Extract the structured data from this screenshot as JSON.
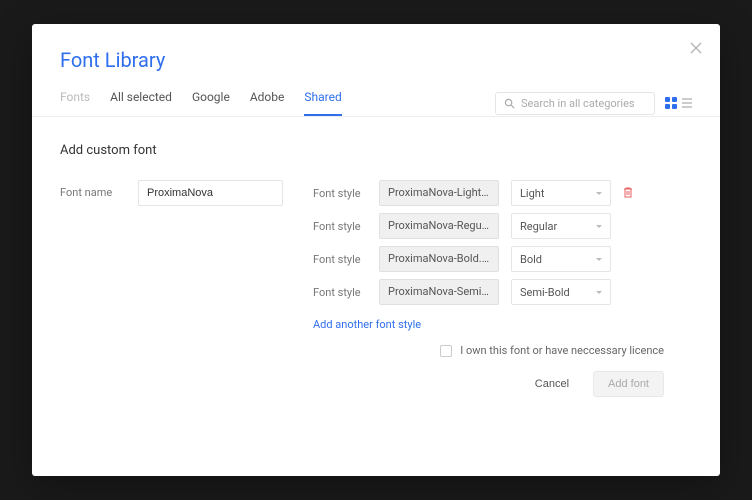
{
  "header": {
    "title": "Font Library"
  },
  "tabs": [
    "Fonts",
    "All selected",
    "Google",
    "Adobe",
    "Shared"
  ],
  "active_tab": 4,
  "search": {
    "placeholder": "Search in all categories"
  },
  "section": {
    "title": "Add custom font"
  },
  "font_name": {
    "label": "Font name",
    "value": "ProximaNova"
  },
  "style_label": "Font style",
  "styles": [
    {
      "file": "ProximaNova-Light.woff",
      "weight": "Light"
    },
    {
      "file": "ProximaNova-Regular.w...",
      "weight": "Regular"
    },
    {
      "file": "ProximaNova-Bold.woff",
      "weight": "Bold"
    },
    {
      "file": "ProximaNova-Semibold....",
      "weight": "Semi-Bold"
    }
  ],
  "add_style_link": "Add another font style",
  "license_text": "I own this font or have neccessary licence",
  "buttons": {
    "cancel": "Cancel",
    "add": "Add font"
  }
}
